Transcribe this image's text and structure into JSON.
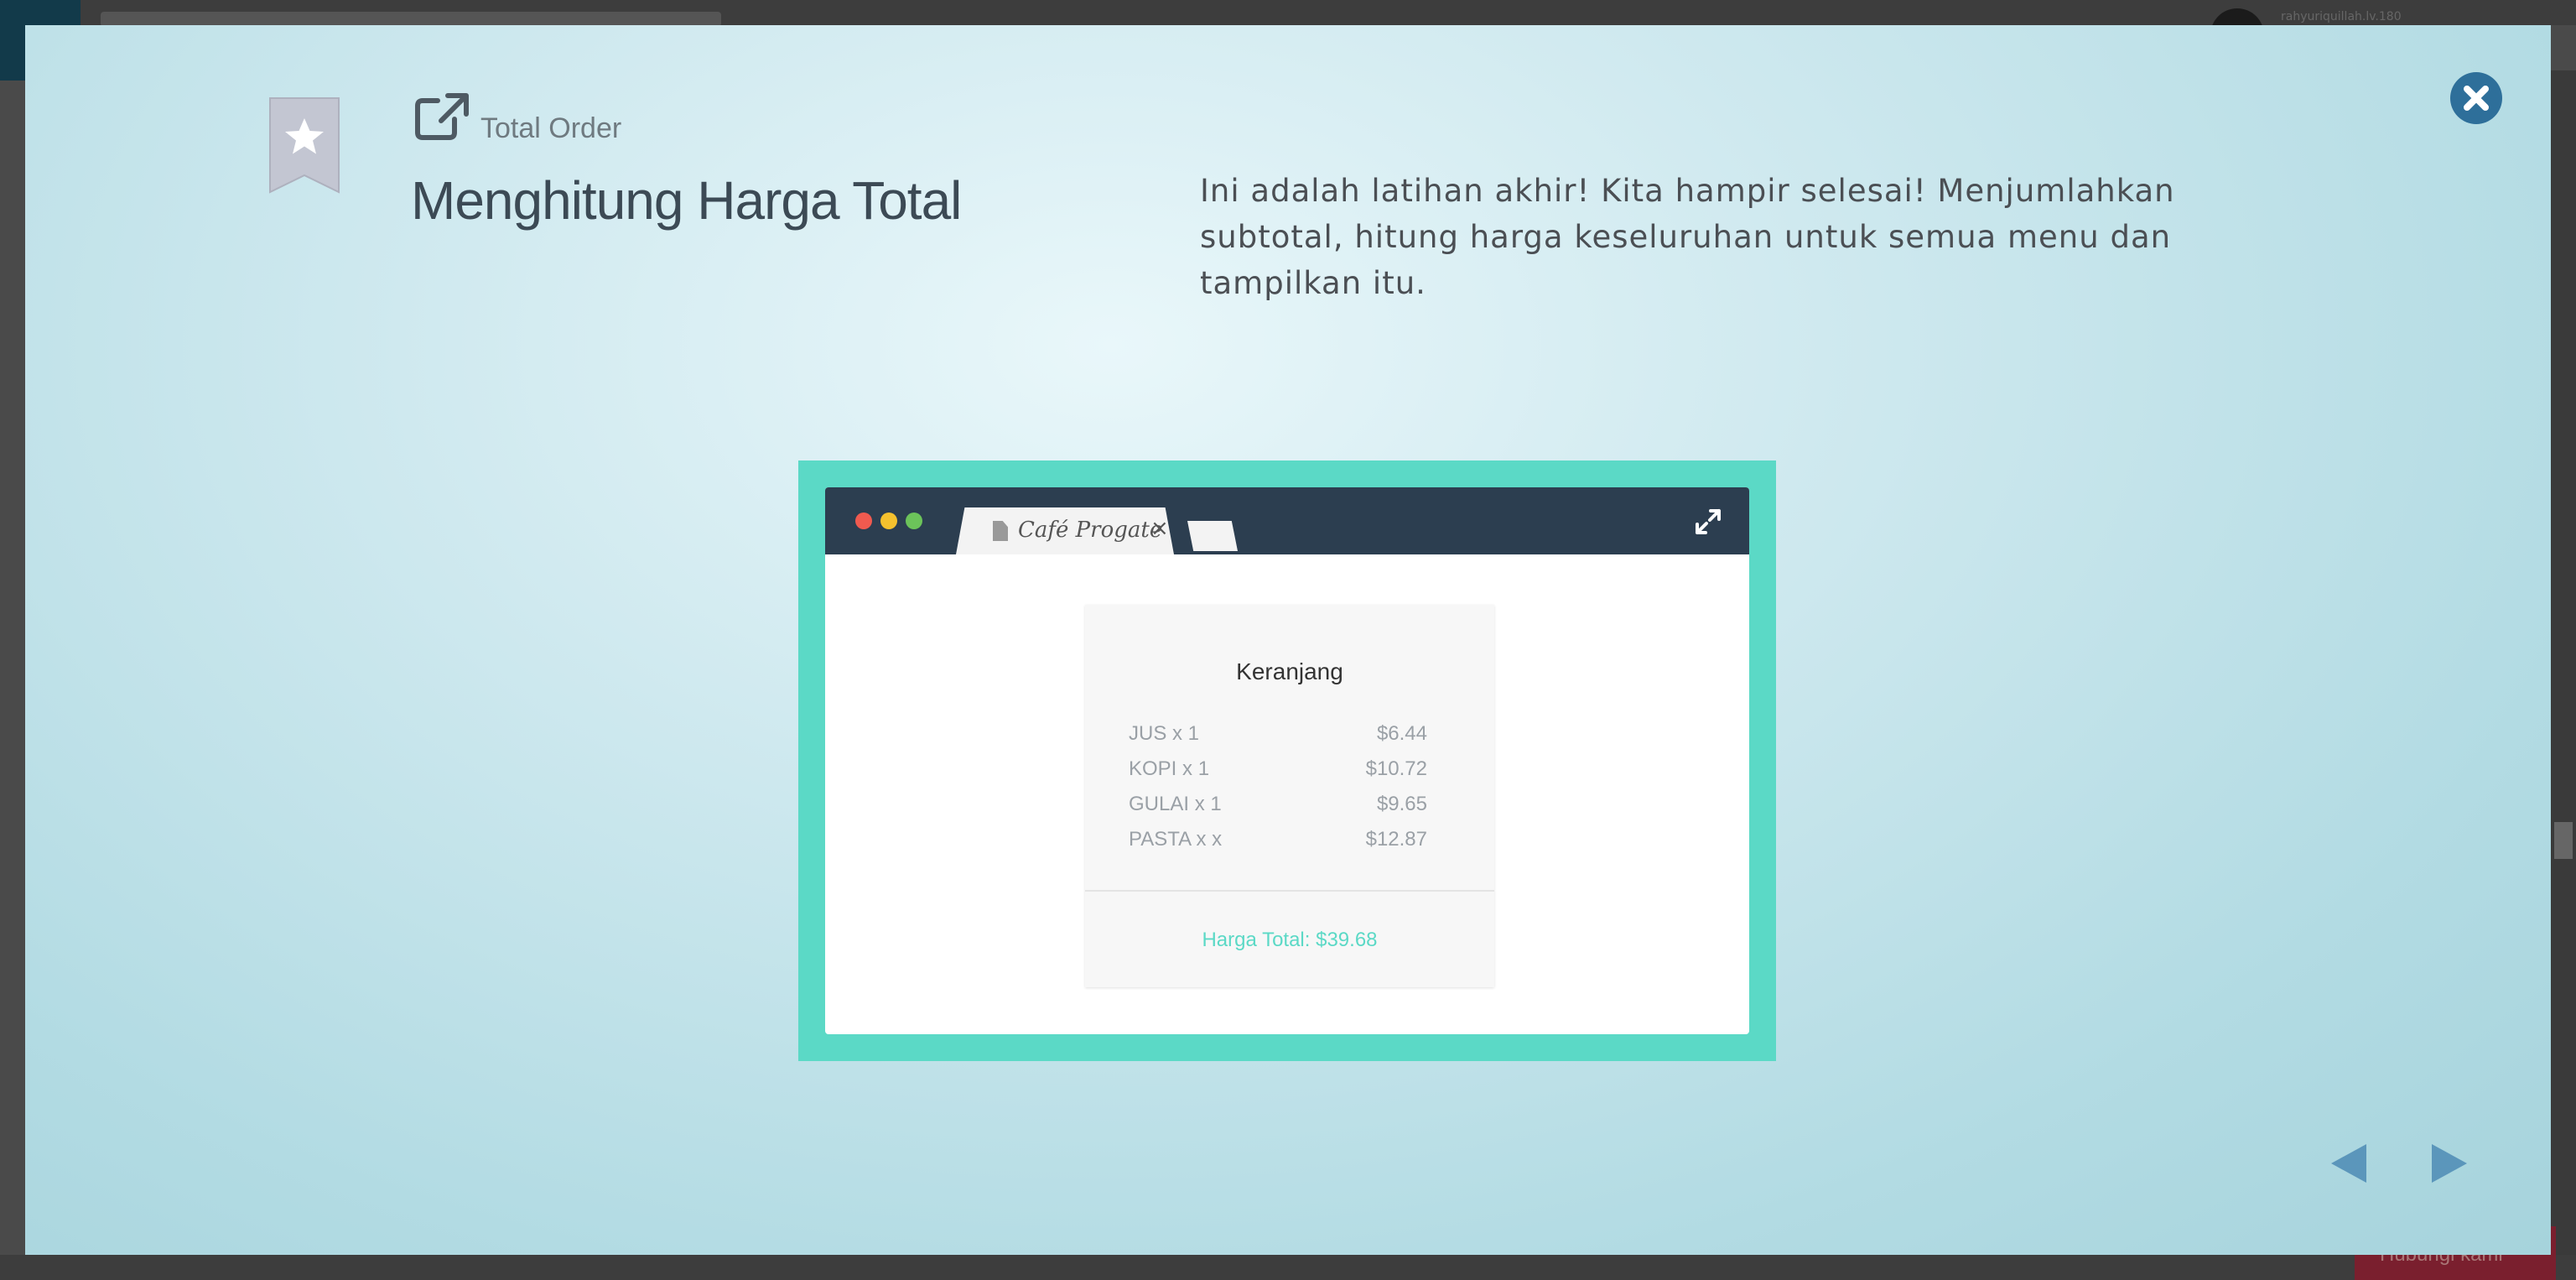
{
  "background": {
    "username": "rahyuriquillah.lv.180",
    "bottom_button_label": "Hubungi kami"
  },
  "slide": {
    "subtitle": "Total Order",
    "title": "Menghitung Harga Total",
    "description": "Ini adalah latihan akhir! Kita hampir selesai! Menjumlahkan subtotal, hitung harga keseluruhan untuk semua menu dan tampilkan itu."
  },
  "illustration": {
    "tab_title": "Café Progate",
    "tab_close": "×",
    "cart": {
      "title": "Keranjang",
      "items": [
        {
          "name": "JUS  x  1",
          "price": "$6.44"
        },
        {
          "name": "KOPI  x  1",
          "price": "$10.72"
        },
        {
          "name": "GULAI  x  1",
          "price": "$9.65"
        },
        {
          "name": "PASTA  x  x",
          "price": "$12.87"
        }
      ],
      "total": "Harga Total: $39.68"
    }
  },
  "colors": {
    "accent_teal": "#5bd9c6",
    "browser_bar": "#2c3e50",
    "close_button": "#2e6f9a",
    "nav_arrows": "#5b96bb"
  },
  "icons": {
    "bookmark": "bookmark-star-icon",
    "external": "external-link-icon",
    "close": "close-icon",
    "prev": "arrow-left-icon",
    "next": "arrow-right-icon",
    "expand": "expand-icon"
  }
}
